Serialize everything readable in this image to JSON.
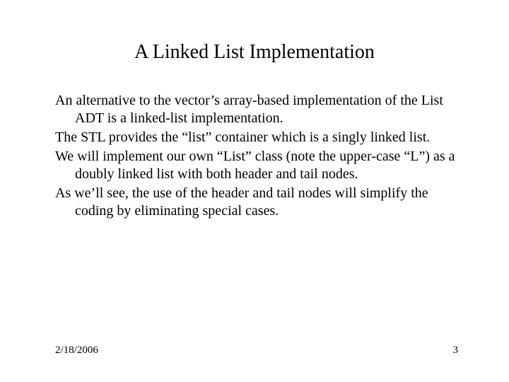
{
  "title": "A Linked List Implementation",
  "paragraphs": [
    "An alternative to the vector’s array-based implementation of the List ADT is a linked-list implementation.",
    "The STL provides the “list” container which is a singly linked list.",
    "We will implement our own “List” class (note the upper-case “L”) as a doubly linked list with both header and tail nodes.",
    "As we’ll see, the use of the header and tail nodes will simplify the coding by eliminating special cases."
  ],
  "footer": {
    "date": "2/18/2006",
    "page": "3"
  }
}
